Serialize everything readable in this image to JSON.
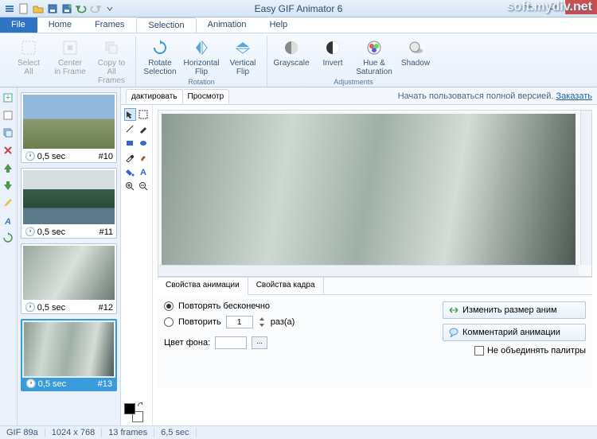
{
  "title": "Easy GIF Animator 6",
  "watermark": "soft.mydiv.net",
  "tabs": {
    "file": "File",
    "home": "Home",
    "frames": "Frames",
    "selection": "Selection",
    "animation": "Animation",
    "help": "Help"
  },
  "ribbon": {
    "selectAll": "Select\nAll",
    "centerInFrame": "Center\nin Frame",
    "copyToAll": "Copy to\nAll Frames",
    "grpSelection": "Selection",
    "rotateSel": "Rotate\nSelection",
    "hflip": "Horizontal\nFlip",
    "vflip": "Vertical\nFlip",
    "grpRotation": "Rotation",
    "grayscale": "Grayscale",
    "invert": "Invert",
    "hueSat": "Hue &\nSaturation",
    "shadow": "Shadow",
    "grpAdjustments": "Adjustments"
  },
  "frames": [
    {
      "time": "0,5 sec",
      "num": "#10",
      "art": "tart-people"
    },
    {
      "time": "0,5 sec",
      "num": "#11",
      "art": "tart-mountain"
    },
    {
      "time": "0,5 sec",
      "num": "#12",
      "art": "tart-winter1"
    },
    {
      "time": "0,5 sec",
      "num": "#13",
      "art": "tart-winter2",
      "selected": true
    }
  ],
  "editor": {
    "tab1": "дактировать",
    "tab2": "Просмотр",
    "trialText": "Начать пользоваться полной версией.",
    "trialLink": "Заказать"
  },
  "props": {
    "tabAnim": "Свойства анимации",
    "tabFrame": "Свойства кадра",
    "loopForever": "Повторять бесконечно",
    "loopN": "Повторить",
    "loopVal": "1",
    "times": "раз(а)",
    "bgColor": "Цвет фона:",
    "resize": "Изменить размер аним",
    "comment": "Комментарий анимации",
    "noMerge": "Не объединять палитры"
  },
  "status": {
    "gif": "GIF 89a",
    "dims": "1024 x 768",
    "frames": "13 frames",
    "dur": "6,5 sec"
  }
}
